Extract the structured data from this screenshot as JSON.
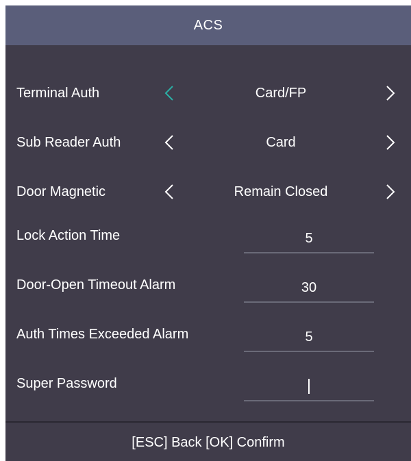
{
  "title": "ACS",
  "colors": {
    "background": "#403c4a",
    "titlebar": "#5a5e7a",
    "accent": "#2ab0a6",
    "text": "#ffffff",
    "underline": "#6a6a78"
  },
  "settings": {
    "terminal_auth": {
      "label": "Terminal Auth",
      "value": "Card/FP",
      "left_icon": "chevron-left-icon",
      "right_icon": "chevron-right-icon"
    },
    "sub_reader_auth": {
      "label": "Sub Reader Auth",
      "value": "Card",
      "left_icon": "chevron-left-icon",
      "right_icon": "chevron-right-icon"
    },
    "door_magnetic": {
      "label": "Door Magnetic",
      "value": "Remain Closed",
      "left_icon": "chevron-left-icon",
      "right_icon": "chevron-right-icon"
    },
    "lock_action_time": {
      "label": "Lock Action Time",
      "value": "5"
    },
    "door_open_timeout_alarm": {
      "label": "Door-Open Timeout Alarm",
      "value": "30"
    },
    "auth_times_exceeded_alarm": {
      "label": "Auth Times Exceeded Alarm",
      "value": "5"
    },
    "super_password": {
      "label": "Super Password",
      "value": ""
    }
  },
  "footer": {
    "hint": "[ESC] Back [OK] Confirm"
  }
}
